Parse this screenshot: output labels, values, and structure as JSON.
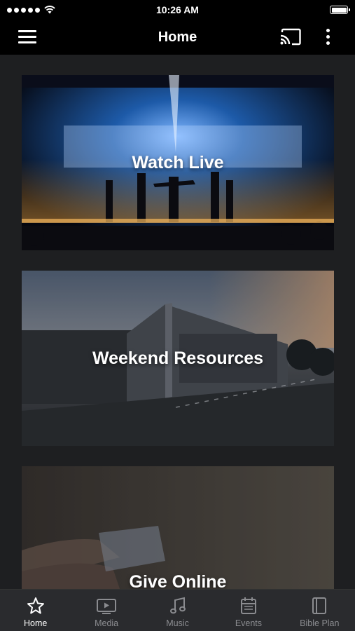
{
  "status_bar": {
    "time": "10:26 AM",
    "signal_icon": "signal-dots-icon",
    "wifi_icon": "wifi-icon",
    "battery_icon": "battery-icon",
    "battery_level": 1.0
  },
  "nav": {
    "title": "Home",
    "menu_icon": "hamburger-icon",
    "cast_icon": "cast-icon",
    "more_icon": "more-vertical-icon"
  },
  "cards": [
    {
      "label": "Watch Live",
      "image": "stage-concert-photo"
    },
    {
      "label": "Weekend Resources",
      "image": "church-building-dusk-photo"
    },
    {
      "label": "Give Online",
      "image": "hand-holding-card-photo"
    }
  ],
  "tabs": [
    {
      "label": "Home",
      "icon": "star-icon",
      "active": true
    },
    {
      "label": "Media",
      "icon": "tv-play-icon",
      "active": false
    },
    {
      "label": "Music",
      "icon": "music-note-icon",
      "active": false
    },
    {
      "label": "Events",
      "icon": "calendar-icon",
      "active": false
    },
    {
      "label": "Bible Plan",
      "icon": "book-icon",
      "active": false
    }
  ],
  "colors": {
    "background": "#1e1f21",
    "bar": "#000000",
    "tabbar": "#2a2b2e",
    "tab_inactive": "#8b8c90",
    "tab_active": "#ffffff"
  }
}
